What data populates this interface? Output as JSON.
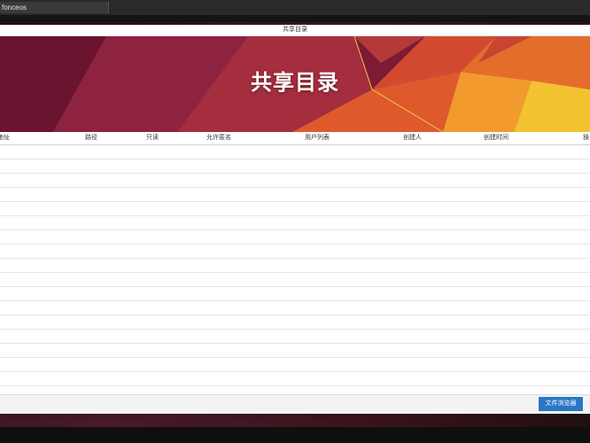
{
  "topbar": {
    "tab_title": "fonceos"
  },
  "window": {
    "title": "共享目录"
  },
  "banner": {
    "title": "共享目录"
  },
  "table": {
    "columns": [
      "地址",
      "路径",
      "只读",
      "允许匿名",
      "用户列表",
      "创建人",
      "创建时间",
      "操"
    ],
    "row_count": 17
  },
  "footer": {
    "file_browser_label": "文件浏览器"
  },
  "colors": {
    "banner_base": "#8b1f3c",
    "banner_orange": "#e7572b",
    "banner_yellow": "#f2c230",
    "button_blue": "#2a76c6"
  }
}
